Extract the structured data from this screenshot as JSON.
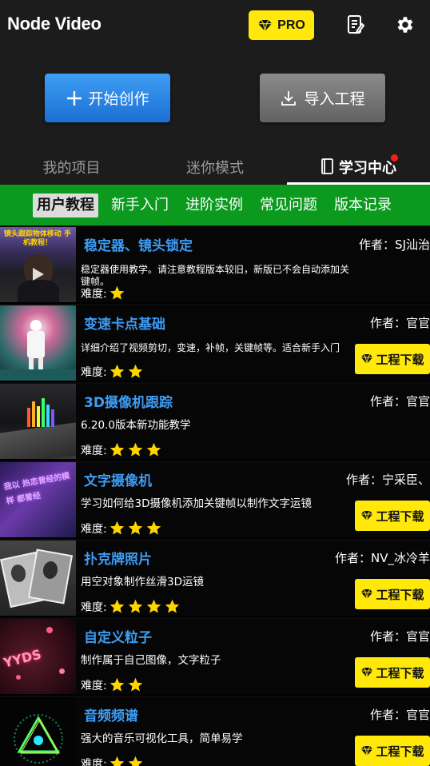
{
  "header": {
    "app_title": "Node Video",
    "pro_label": "PRO",
    "icons": [
      "diamond-icon",
      "notes-icon",
      "gear-icon"
    ]
  },
  "actions": {
    "create_label": "开始创作",
    "import_label": "导入工程"
  },
  "tabs": {
    "projects": "我的项目",
    "mini": "迷你模式",
    "learn": "学习中心",
    "active": "学习中心"
  },
  "subtabs": {
    "items": [
      "用户教程",
      "新手入门",
      "进阶实例",
      "常见问题",
      "版本记录"
    ],
    "active": "用户教程"
  },
  "tutorials": {
    "difficulty_label": "难度:",
    "download_label": "工程下载",
    "items": [
      {
        "title": "稳定器、镜头锁定",
        "author": "作者：SJ汕治",
        "description": "稳定器使用教学。请注意教程版本较旧，新版已不会自动添加关键帧。",
        "difficulty": 1,
        "has_download": false,
        "thumb_caption": "镜头跟踪物体移动 手机教程！"
      },
      {
        "title": "变速卡点基础",
        "author": "作者：官官",
        "description": "详细介绍了视频剪切，变速，补帧，关键帧等。适合新手入门",
        "difficulty": 2,
        "has_download": true
      },
      {
        "title": "3D摄像机跟踪",
        "author": "作者：官官",
        "description": "6.20.0版本新功能教学",
        "difficulty": 3,
        "has_download": false
      },
      {
        "title": "文字摄像机",
        "author": "作者：宁采臣、",
        "description": "学习如何给3D摄像机添加关键帧以制作文字运镜",
        "difficulty": 3,
        "has_download": true,
        "thumb_caption": "我以 热恋曾经的模样 都曾经"
      },
      {
        "title": "扑克牌照片",
        "author": "作者：NV_冰冷羊",
        "description": "用空对象制作丝滑3D运镜",
        "difficulty": 4,
        "has_download": true
      },
      {
        "title": "自定义粒子",
        "author": "作者：官官",
        "description": "制作属于自己图像，文字粒子",
        "difficulty": 2,
        "has_download": true,
        "thumb_caption": "YYDS"
      },
      {
        "title": "音频频谱",
        "author": "作者：官官",
        "description": "强大的音乐可视化工具，简单易学",
        "difficulty": 2,
        "has_download": true
      }
    ]
  },
  "colors": {
    "accent_blue": "#3d9cf4",
    "pro_yellow": "#ffe80a",
    "subtab_green": "#0b9a1e",
    "badge_red": "#ff1a1a",
    "star_yellow": "#ffd500"
  }
}
